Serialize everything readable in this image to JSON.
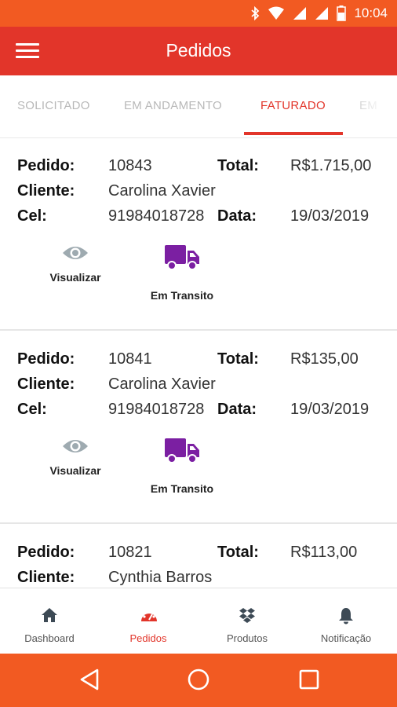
{
  "status_bar": {
    "time": "10:04"
  },
  "app_bar": {
    "title": "Pedidos",
    "menu_icon": "hamburger-menu-icon"
  },
  "tabs": [
    {
      "label": "SOLICITADO",
      "active": false
    },
    {
      "label": "EM ANDAMENTO",
      "active": false
    },
    {
      "label": "FATURADO",
      "active": true
    },
    {
      "label": "EM",
      "active": false
    }
  ],
  "labels": {
    "pedido": "Pedido:",
    "cliente": "Cliente:",
    "cel": "Cel:",
    "total": "Total:",
    "data": "Data:"
  },
  "orders": [
    {
      "pedido": "10843",
      "cliente": "Carolina  Xavier",
      "cel": "91984018728",
      "total": "R$1.715,00",
      "data": "19/03/2019",
      "visualizar": "Visualizar",
      "status": "Em Transito"
    },
    {
      "pedido": "10841",
      "cliente": "Carolina  Xavier",
      "cel": "91984018728",
      "total": "R$135,00",
      "data": "19/03/2019",
      "visualizar": "Visualizar",
      "status": "Em Transito"
    },
    {
      "pedido": "10821",
      "cliente": "Cynthia Barros",
      "total": "R$113,00"
    }
  ],
  "bottom_nav": [
    {
      "label": "Dashboard",
      "icon": "home-icon",
      "active": false
    },
    {
      "label": "Pedidos",
      "icon": "dashboard-gauge-icon",
      "active": true
    },
    {
      "label": "Produtos",
      "icon": "dropbox-box-icon",
      "active": false
    },
    {
      "label": "Notificação",
      "icon": "bell-icon",
      "active": false
    }
  ],
  "colors": {
    "status_bar": "#f25a22",
    "app_bar": "#e2352a",
    "accent": "#e2352a",
    "truck": "#7b1fa2",
    "eye": "#9eaab0",
    "nav_icon": "#3d4a55"
  }
}
